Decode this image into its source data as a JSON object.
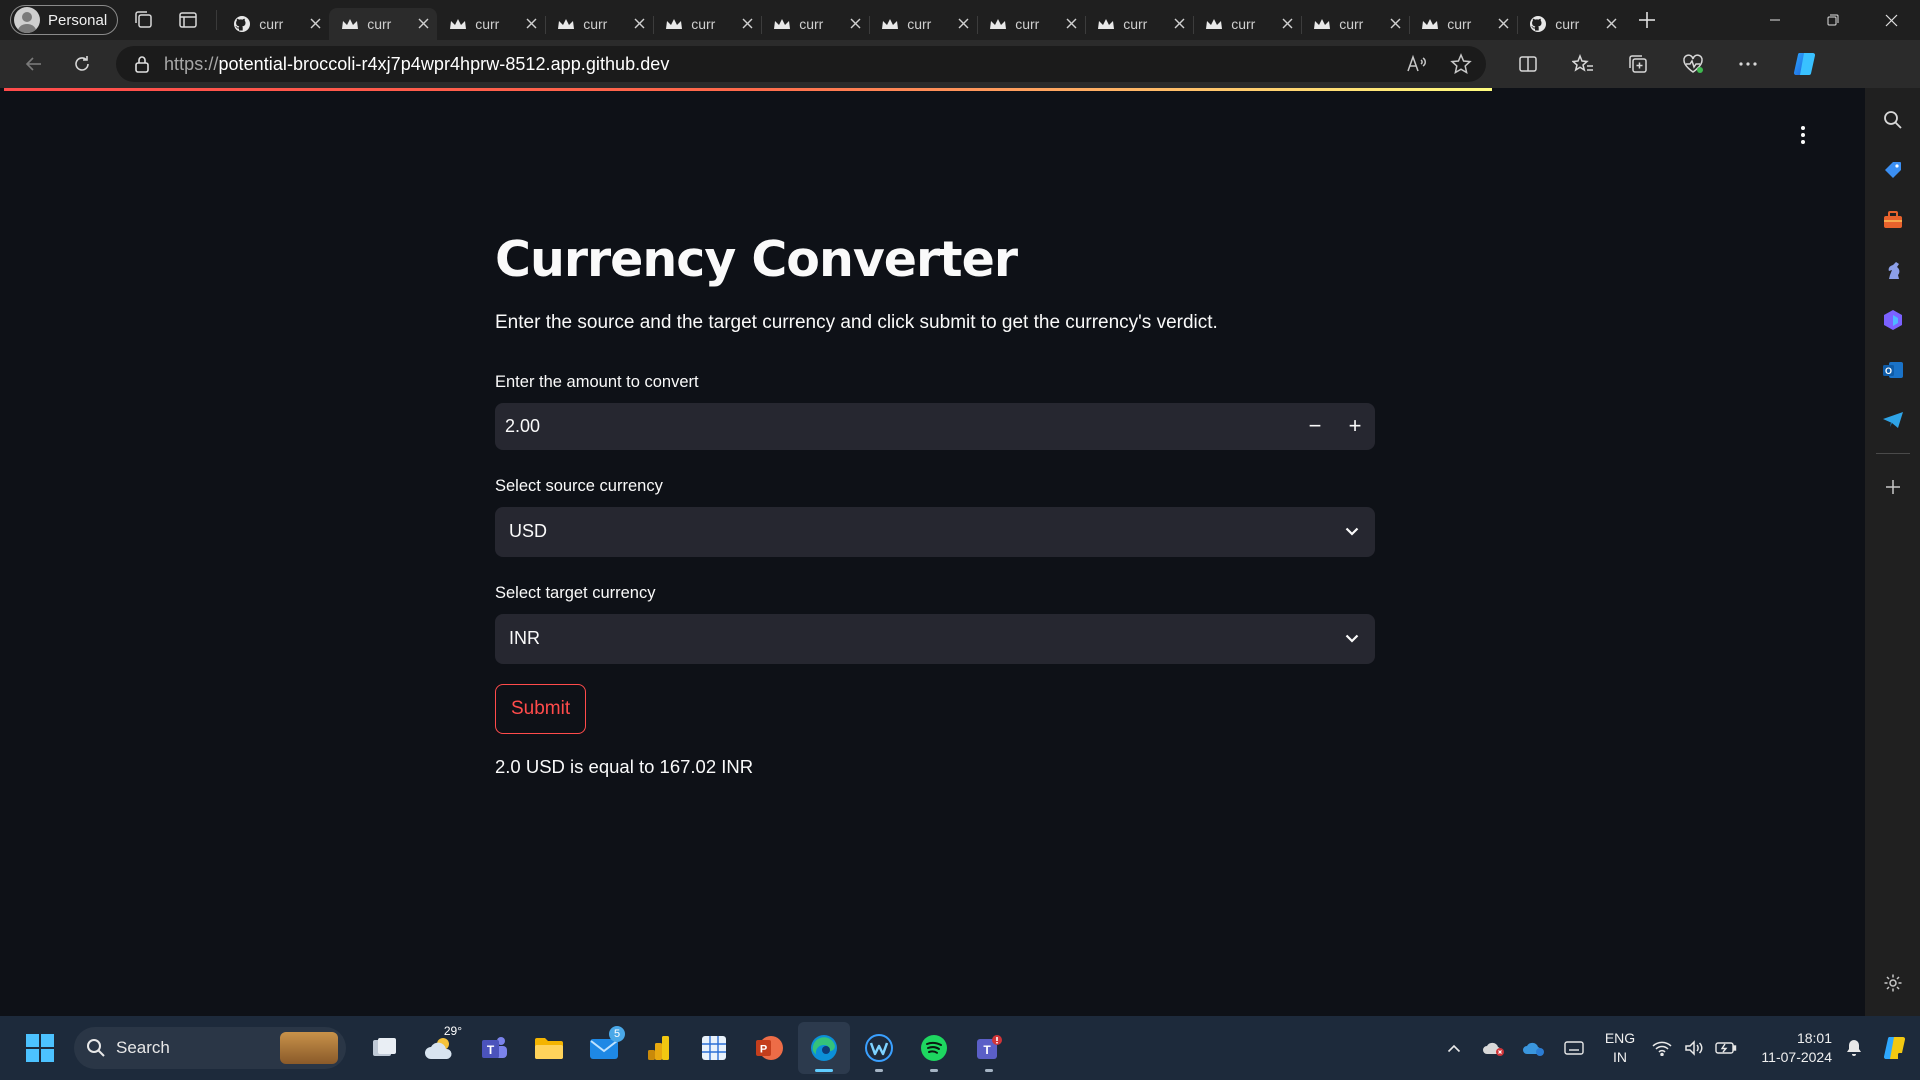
{
  "browser": {
    "profile_label": "Personal",
    "tabs": [
      {
        "title": "curr",
        "icon": "github-icon"
      },
      {
        "title": "curr",
        "icon": "streamlit-crown-icon"
      },
      {
        "title": "curr",
        "icon": "streamlit-crown-icon"
      },
      {
        "title": "curr",
        "icon": "streamlit-crown-icon"
      },
      {
        "title": "curr",
        "icon": "streamlit-crown-icon"
      },
      {
        "title": "curr",
        "icon": "streamlit-crown-icon"
      },
      {
        "title": "curr",
        "icon": "streamlit-crown-icon"
      },
      {
        "title": "curr",
        "icon": "streamlit-crown-icon"
      },
      {
        "title": "curr",
        "icon": "streamlit-crown-icon"
      },
      {
        "title": "curr",
        "icon": "streamlit-crown-icon"
      },
      {
        "title": "curr",
        "icon": "streamlit-crown-icon"
      },
      {
        "title": "curr",
        "icon": "streamlit-crown-icon"
      },
      {
        "title": "curr",
        "icon": "github-icon"
      }
    ],
    "active_tab_index": 1,
    "url_protocol": "https://",
    "url_host": "potential-broccoli-r4xj7p4wpr4hprw-8512.app.github.dev"
  },
  "app": {
    "title": "Currency Converter",
    "description": "Enter the source and the target currency and click submit to get the currency's verdict.",
    "amount_label": "Enter the amount to convert",
    "amount_value": "2.00",
    "decrement_symbol": "−",
    "increment_symbol": "+",
    "source_label": "Select source currency",
    "source_value": "USD",
    "target_label": "Select target currency",
    "target_value": "INR",
    "submit_label": "Submit",
    "result_text": "2.0 USD is equal to 167.02 INR",
    "colors": {
      "background": "#0e1117",
      "input_bg": "#262730",
      "primary": "#ff4b4b",
      "text": "#fafafa"
    }
  },
  "taskbar": {
    "search_label": "Search",
    "weather_temp": "29°",
    "mail_badge": "5",
    "lang_line1": "ENG",
    "lang_line2": "IN",
    "time": "18:01",
    "date": "11-07-2024"
  }
}
